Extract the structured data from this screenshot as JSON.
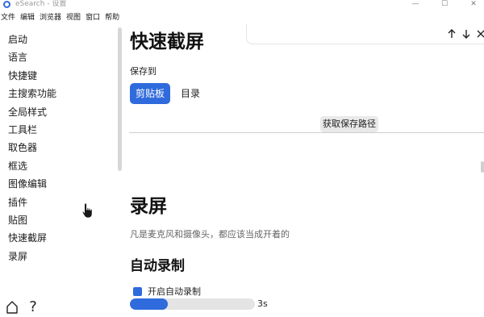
{
  "window": {
    "title": "eSearch - 设置",
    "controls": [
      "—",
      "☐",
      "✕"
    ]
  },
  "menu": [
    "文件",
    "编辑",
    "浏览器",
    "视图",
    "窗口",
    "帮助"
  ],
  "sidebar": {
    "items": [
      "启动",
      "语言",
      "快捷键",
      "主搜索功能",
      "全局样式",
      "工具栏",
      "取色器",
      "框选",
      "图像编辑",
      "插件",
      "贴图",
      "快速截屏",
      "录屏"
    ]
  },
  "search_panel": {
    "prev_icon": "arrow-up-icon",
    "next_icon": "arrow-down-icon",
    "close_icon": "close-icon"
  },
  "quick_screenshot": {
    "title": "快速截屏",
    "save_to_label": "保存到",
    "options": [
      "剪贴板",
      "目录"
    ],
    "selected": "剪贴板",
    "get_path_button": "获取保存路径"
  },
  "recording": {
    "title": "录屏",
    "description": "凡是麦克风和摄像头，都应该当成开着的",
    "auto_section": {
      "title": "自动录制",
      "enable_label": "开启自动录制",
      "enabled": true,
      "delay_value": "3s",
      "delay_fraction": 0.3
    }
  },
  "bottom": {
    "home_icon": "home-icon",
    "help_icon": "question-icon",
    "help_text": "?"
  },
  "colors": {
    "accent": "#2f6bdc"
  }
}
